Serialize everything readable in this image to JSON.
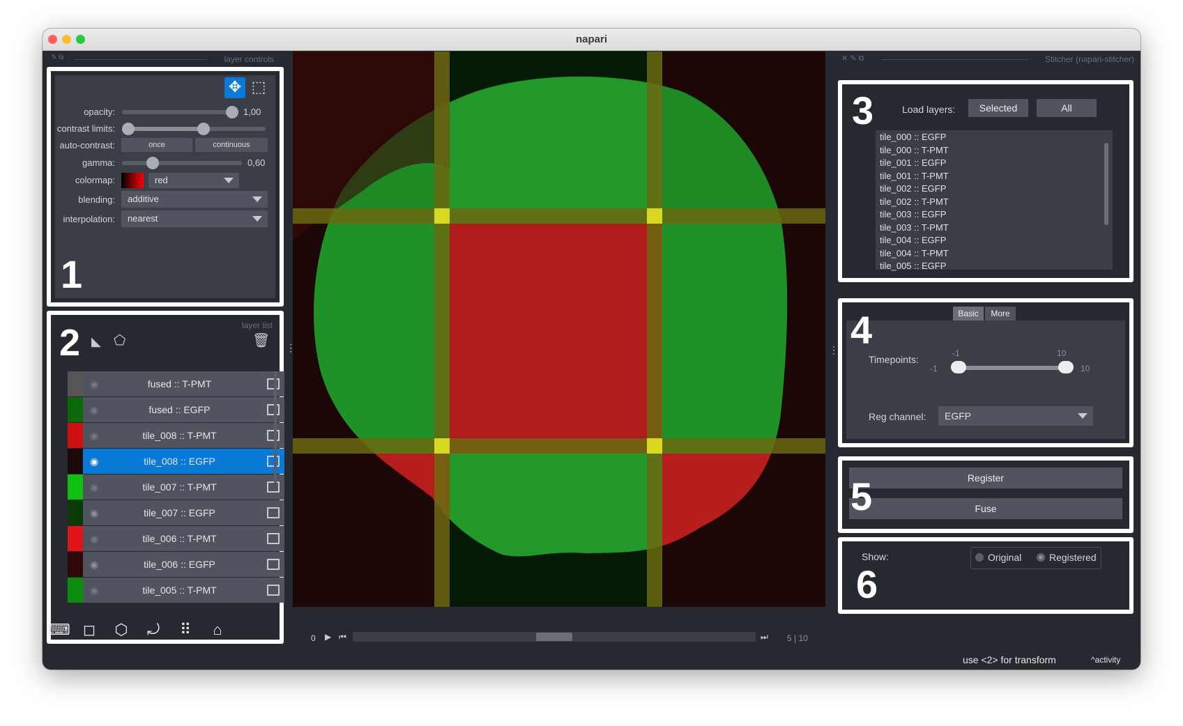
{
  "window": {
    "title": "napari"
  },
  "colors": {
    "accent": "#0a7ad8",
    "panel": "#262930",
    "widget": "#3b3e46",
    "control": "#50545e"
  },
  "layer_controls": {
    "header": "layer controls",
    "number": "1",
    "opacity_label": "opacity:",
    "opacity_value": "1,00",
    "opacity_level": 1.0,
    "contrast_label": "contrast limits:",
    "contrast_range": [
      0.0,
      0.38
    ],
    "autocontrast_label": "auto-contrast:",
    "once_label": "once",
    "continuous_label": "continuous",
    "gamma_label": "gamma:",
    "gamma_value": "0,60",
    "colormap_label": "colormap:",
    "colormap_value": "red",
    "blending_label": "blending:",
    "blending_value": "additive",
    "interpolation_label": "interpolation:",
    "interpolation_value": "nearest"
  },
  "layer_list": {
    "header": "layer list",
    "number": "2",
    "layers": [
      {
        "name": "fused :: T-PMT",
        "thumb": "#555",
        "visible": false,
        "selected": false
      },
      {
        "name": "fused :: EGFP",
        "thumb": "#0a6a0a",
        "visible": false,
        "selected": false
      },
      {
        "name": "tile_008 :: T-PMT",
        "thumb": "#d01010",
        "visible": false,
        "selected": false
      },
      {
        "name": "tile_008 :: EGFP",
        "thumb": "#1a0a0a",
        "visible": true,
        "selected": true
      },
      {
        "name": "tile_007 :: T-PMT",
        "thumb": "#10c010",
        "visible": false,
        "selected": false
      },
      {
        "name": "tile_007 :: EGFP",
        "thumb": "#0a3a0a",
        "visible": true,
        "selected": false
      },
      {
        "name": "tile_006 :: T-PMT",
        "thumb": "#e01515",
        "visible": false,
        "selected": false
      },
      {
        "name": "tile_006 :: EGFP",
        "thumb": "#300808",
        "visible": true,
        "selected": false
      },
      {
        "name": "tile_005 :: T-PMT",
        "thumb": "#0c8c0c",
        "visible": false,
        "selected": false
      }
    ]
  },
  "viewer": {
    "dims_start": "0",
    "dims_current": "5",
    "dims_max": "10",
    "dims_position": 0.5
  },
  "stitcher": {
    "header": "Stitcher (napari-stitcher)",
    "section3": {
      "number": "3",
      "load_label": "Load layers:",
      "selected_btn": "Selected",
      "all_btn": "All",
      "items": [
        "tile_000 :: EGFP",
        "tile_000 :: T-PMT",
        "tile_001 :: EGFP",
        "tile_001 :: T-PMT",
        "tile_002 :: EGFP",
        "tile_002 :: T-PMT",
        "tile_003 :: EGFP",
        "tile_003 :: T-PMT",
        "tile_004 :: EGFP",
        "tile_004 :: T-PMT",
        "tile_005 :: EGFP"
      ]
    },
    "section4": {
      "number": "4",
      "tab_basic": "Basic",
      "tab_more": "More",
      "timepoints_label": "Timepoints:",
      "tp_low_top": "-1",
      "tp_high_top": "10",
      "tp_min": "-1",
      "tp_max": "10",
      "reg_channel_label": "Reg channel:",
      "reg_channel_value": "EGFP"
    },
    "section5": {
      "number": "5",
      "register_btn": "Register",
      "fuse_btn": "Fuse"
    },
    "section6": {
      "number": "6",
      "show_label": "Show:",
      "original": "Original",
      "registered": "Registered"
    }
  },
  "statusbar": {
    "hint": "use <2> for transform",
    "activity": "activity"
  }
}
